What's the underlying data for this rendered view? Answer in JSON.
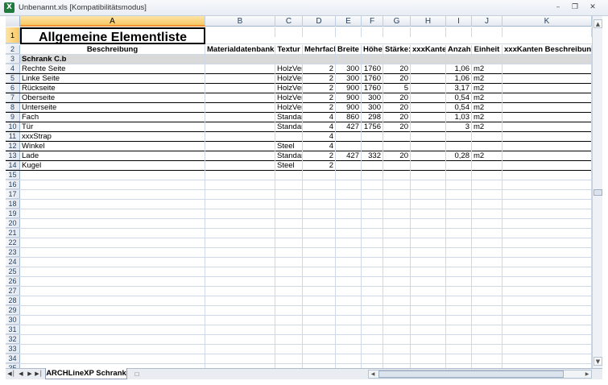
{
  "window": {
    "title": "Unbenannt.xls  [Kompatibilitätsmodus]",
    "app_icon": "excel-icon",
    "controls": [
      "minimize-icon",
      "restore-icon",
      "close-icon"
    ]
  },
  "columns": [
    "A",
    "B",
    "C",
    "D",
    "E",
    "F",
    "G",
    "H",
    "I",
    "J",
    "K"
  ],
  "selected_column": "A",
  "selected_row": "1",
  "sheet": {
    "title": "Allgemeine Elementliste",
    "headers": [
      "Beschreibung",
      "Materialdatenbank",
      "Textur",
      "Mehrfach",
      "Breite",
      "Höhe",
      "Stärke:",
      "xxxKante",
      "Anzahl",
      "Einheit",
      "xxxKanten Beschreibung"
    ],
    "group": "Schrank C.b",
    "rows": [
      [
        "Rechte Seite",
        "",
        "HolzVer",
        "2",
        "300",
        "1760",
        "20",
        "",
        "1,06",
        "m2",
        ""
      ],
      [
        "Linke Seite",
        "",
        "HolzVer",
        "2",
        "300",
        "1760",
        "20",
        "",
        "1,06",
        "m2",
        ""
      ],
      [
        "Rückseite",
        "",
        "HolzVer",
        "2",
        "900",
        "1760",
        "5",
        "",
        "3,17",
        "m2",
        ""
      ],
      [
        "Oberseite",
        "",
        "HolzVer",
        "2",
        "900",
        "300",
        "20",
        "",
        "0,54",
        "m2",
        ""
      ],
      [
        "Unterseite",
        "",
        "HolzVer",
        "2",
        "900",
        "300",
        "20",
        "",
        "0,54",
        "m2",
        ""
      ],
      [
        "Fach",
        "",
        "Standar",
        "4",
        "860",
        "298",
        "20",
        "",
        "1,03",
        "m2",
        ""
      ],
      [
        "Tür",
        "",
        "Standar",
        "4",
        "427",
        "1756",
        "20",
        "",
        "3",
        "m2",
        ""
      ],
      [
        "xxxStrap",
        "",
        "",
        "4",
        "",
        "",
        "",
        "",
        "",
        "",
        ""
      ],
      [
        "Winkel",
        "",
        "Steel",
        "4",
        "",
        "",
        "",
        "",
        "",
        "",
        ""
      ],
      [
        "Lade",
        "",
        "Standar",
        "2",
        "427",
        "332",
        "20",
        "",
        "0,28",
        "m2",
        ""
      ],
      [
        "Kugel",
        "",
        "Steel",
        "2",
        "",
        "",
        "",
        "",
        "",
        "",
        ""
      ]
    ],
    "row_numbers": [
      "1",
      "2",
      "3",
      "4",
      "5",
      "6",
      "7",
      "8",
      "9",
      "10",
      "11",
      "12",
      "13",
      "14",
      "15",
      "16",
      "17",
      "18",
      "19",
      "20",
      "21",
      "22",
      "23",
      "24",
      "25",
      "26",
      "27",
      "28",
      "29",
      "30",
      "31",
      "32",
      "33",
      "34",
      "35"
    ]
  },
  "tabs": {
    "active": "ARCHLineXP Schrank",
    "nav_icons": [
      "first-sheet-icon",
      "prev-sheet-icon",
      "next-sheet-icon",
      "last-sheet-icon"
    ],
    "new_sheet_icon": "new-sheet-icon"
  }
}
